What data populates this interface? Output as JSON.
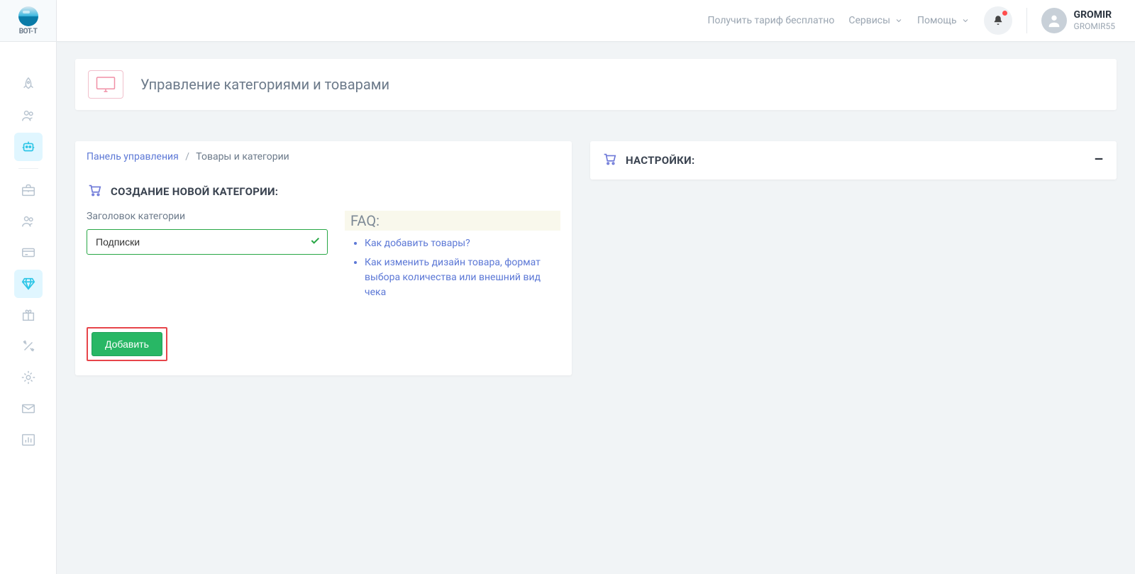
{
  "logo": {
    "text1": "BOT",
    "text2": "-T"
  },
  "topbar": {
    "tariff": "Получить тариф бесплатно",
    "services": "Сервисы",
    "help": "Помощь"
  },
  "user": {
    "name": "GROMIR",
    "handle": "GROMIR55"
  },
  "page": {
    "title": "Управление категориями и товарами"
  },
  "breadcrumb": {
    "root": "Панель управления",
    "current": "Товары и категории",
    "sep": "/"
  },
  "panel_create": {
    "title": "СОЗДАНИЕ НОВОЙ КАТЕГОРИИ:",
    "label": "Заголовок категории",
    "value": "Подписки",
    "add_button": "Добавить"
  },
  "faq": {
    "title": "FAQ:",
    "items": [
      "Как добавить товары?",
      "Как изменить дизайн товара, формат выбора количества или внешний вид чека"
    ]
  },
  "panel_settings": {
    "title": "НАСТРОЙКИ:"
  }
}
